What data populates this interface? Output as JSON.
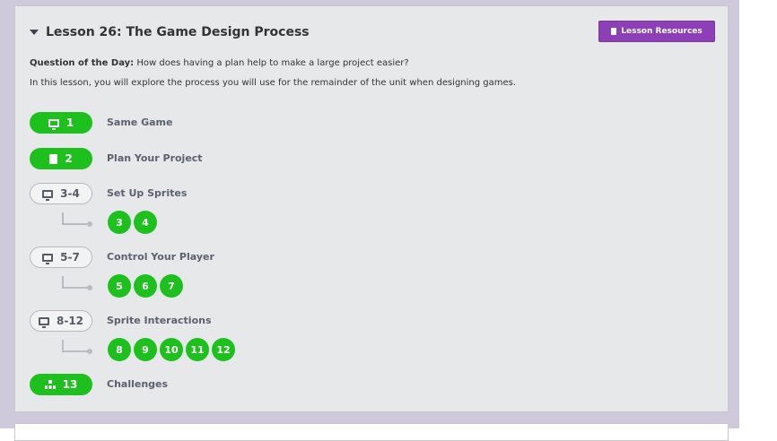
{
  "lesson": {
    "title": "Lesson 26: The Game Design Process",
    "resources_label": "Lesson Resources",
    "question_label": "Question of the Day:",
    "question_text": "How does having a plan help to make a large project easier?",
    "intro": "In this lesson, you will explore the process you will use for the remainder of the unit when designing games."
  },
  "activities": [
    {
      "pill": "1",
      "label": "Same Game",
      "icon": "monitor-icon",
      "style": "green"
    },
    {
      "pill": "2",
      "label": "Plan Your Project",
      "icon": "doc-icon",
      "style": "green"
    },
    {
      "pill": "3-4",
      "label": "Set Up Sprites",
      "icon": "monitor-icon",
      "style": "gray",
      "levels": [
        "3",
        "4"
      ]
    },
    {
      "pill": "5-7",
      "label": "Control Your Player",
      "icon": "monitor-icon",
      "style": "gray",
      "levels": [
        "5",
        "6",
        "7"
      ]
    },
    {
      "pill": "8-12",
      "label": "Sprite Interactions",
      "icon": "monitor-icon",
      "style": "gray",
      "levels": [
        "8",
        "9",
        "10",
        "11",
        "12"
      ]
    },
    {
      "pill": "13",
      "label": "Challenges",
      "icon": "tree-icon",
      "style": "green"
    }
  ],
  "colors": {
    "green": "#1ec01e",
    "purple_button": "#8d3fb8"
  }
}
